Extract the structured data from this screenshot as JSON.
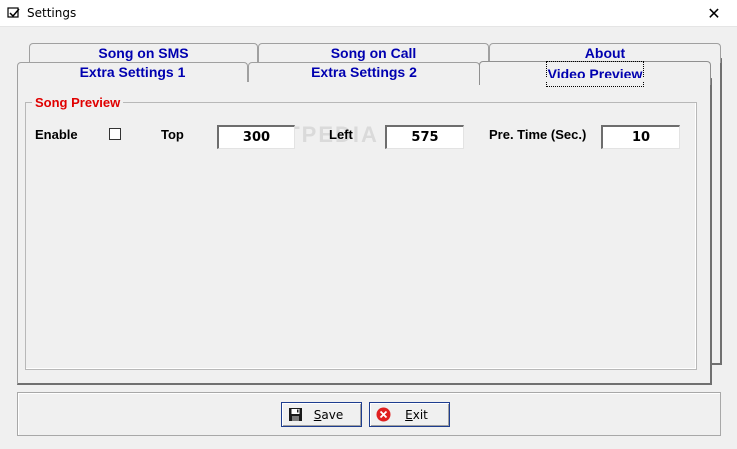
{
  "window": {
    "title": "Settings",
    "close_glyph": "✕"
  },
  "tabs": {
    "row_back": [
      {
        "label": "Song on SMS"
      },
      {
        "label": "Song on Call"
      },
      {
        "label": "About"
      }
    ],
    "row_front": [
      {
        "label": "Extra Settings 1"
      },
      {
        "label": "Extra Settings 2"
      },
      {
        "label": "Video Preview",
        "active": true
      }
    ]
  },
  "group": {
    "title": "Song Preview",
    "title_color": "#e00000"
  },
  "fields": {
    "enable_label": "Enable",
    "enable_checked": false,
    "top_label": "Top",
    "top_value": "300",
    "left_label": "Left",
    "left_value": "575",
    "pretime_label": "Pre. Time (Sec.)",
    "pretime_value": "10"
  },
  "watermark": "SOFTPEDIA",
  "buttons": {
    "save": {
      "mnemonic": "S",
      "rest": "ave",
      "icon": "floppy-disk-icon"
    },
    "exit": {
      "mnemonic": "E",
      "rest": "xit",
      "icon": "red-x-circle-icon"
    }
  },
  "colors": {
    "tab_text": "#0000b0",
    "button_border": "#1e3d8f"
  }
}
